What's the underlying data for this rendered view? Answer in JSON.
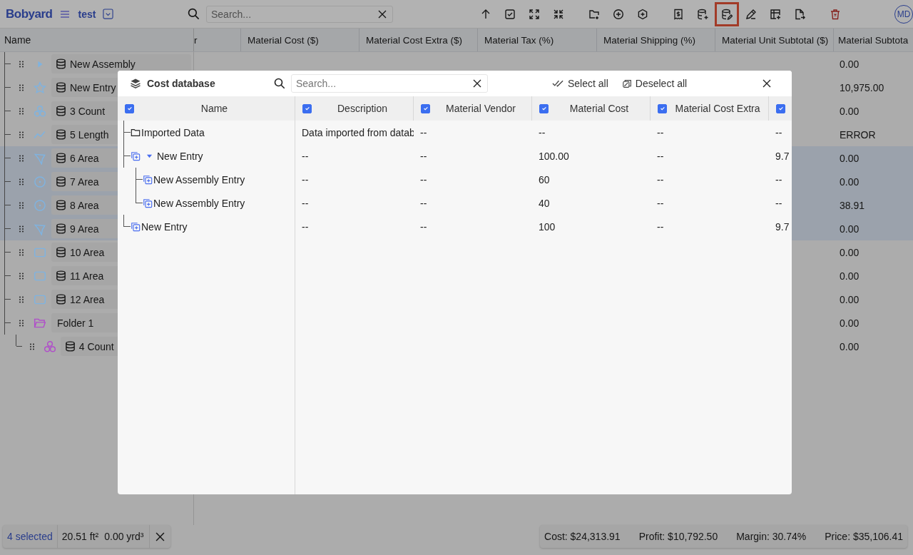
{
  "topbar": {
    "logo": "Bobyard",
    "project": "test",
    "search": {
      "placeholder": "Search..."
    },
    "toolbar": [
      [
        {
          "kind": "arrow-up",
          "selected": false
        },
        {
          "kind": "checkbox",
          "selected": false
        },
        {
          "kind": "expand",
          "selected": false
        },
        {
          "kind": "collapse",
          "selected": false
        }
      ],
      [
        {
          "kind": "folder-plus",
          "selected": false
        },
        {
          "kind": "plus-circle",
          "selected": false
        },
        {
          "kind": "plus-hexagon",
          "selected": false
        }
      ],
      [
        {
          "kind": "receipt",
          "selected": false
        },
        {
          "kind": "database-plus",
          "selected": false
        },
        {
          "kind": "database-edit",
          "selected": true
        },
        {
          "kind": "pencil",
          "selected": false
        },
        {
          "kind": "table-plus",
          "selected": false
        },
        {
          "kind": "file-arrow",
          "selected": false
        }
      ],
      [
        {
          "kind": "trash",
          "selected": false
        }
      ]
    ],
    "avatar": "MD"
  },
  "table": {
    "name_heading": "Name",
    "columns": [
      "r",
      "Material Cost ($)",
      "Material Cost Extra ($)",
      "Material Tax (%)",
      "Material Shipping (%)",
      "Material Unit Subtotal ($)",
      "Material Subtota"
    ]
  },
  "tree": [
    {
      "name": "New Assembly",
      "kind": "assembly",
      "color": "#7fb3e0",
      "selected": false,
      "subtotal": "0.00"
    },
    {
      "name": "New Entry",
      "kind": "star",
      "color": "#7fb3e0",
      "selected": false,
      "subtotal": "10,975.00"
    },
    {
      "name": "3 Count",
      "kind": "count",
      "color": "#7fb3e0",
      "selected": false,
      "subtotal": "0.00"
    },
    {
      "name": "5 Length",
      "kind": "length",
      "color": "#7fb3e0",
      "selected": false,
      "subtotal": "ERROR"
    },
    {
      "name": "6 Area",
      "kind": "polygon",
      "color": "#7fb3e0",
      "selected": true,
      "subtotal": "0.00"
    },
    {
      "name": "7 Area",
      "kind": "circle",
      "color": "#7fb3e0",
      "selected": true,
      "subtotal": "0.00"
    },
    {
      "name": "8 Area",
      "kind": "circle",
      "color": "#7fb3e0",
      "selected": true,
      "subtotal": "38.91"
    },
    {
      "name": "9 Area",
      "kind": "polygon",
      "color": "#7fb3e0",
      "selected": true,
      "subtotal": "0.00"
    },
    {
      "name": "10 Area",
      "kind": "rect",
      "color": "#7fb3e0",
      "selected": false,
      "subtotal": "0.00"
    },
    {
      "name": "11 Area",
      "kind": "rect",
      "color": "#7fb3e0",
      "selected": false,
      "subtotal": "0.00"
    },
    {
      "name": "12 Area",
      "kind": "rect",
      "color": "#7fb3e0",
      "selected": false,
      "subtotal": "0.00"
    },
    {
      "name": "Folder 1",
      "kind": "folder",
      "color": "#b04fc9",
      "selected": false,
      "subtotal": "0.00",
      "children": [
        {
          "name": "4 Count",
          "kind": "count",
          "color": "#b04fc9",
          "selected": false,
          "subtotal": "0.00"
        }
      ]
    }
  ],
  "selection": {
    "count": "4 selected",
    "area": "20.51 ft²",
    "volume": "0.00 yrd³"
  },
  "totals": [
    "Cost: $24,313.91",
    "Profit: $10,792.50",
    "Margin: 30.74%",
    "Price: $35,106.41"
  ],
  "modal": {
    "title": "Cost database",
    "search": {
      "placeholder": "Search..."
    },
    "select_all": "Select all",
    "deselect_all": "Deselect all",
    "name_column": {
      "label": "Name",
      "checked": true
    },
    "columns": [
      {
        "label": "Description",
        "checked": true
      },
      {
        "label": "Material Vendor",
        "checked": true
      },
      {
        "label": "Material Cost",
        "checked": true
      },
      {
        "label": "Material Cost Extra",
        "checked": true
      },
      {
        "checked": true
      }
    ],
    "rows": [
      {
        "name": "Imported Data",
        "kind": "folder",
        "cells": [
          "Data imported from datab",
          "--",
          "--",
          "--",
          "--"
        ]
      },
      {
        "name": "New Entry",
        "kind": "entry",
        "expanded": true,
        "cells": [
          "--",
          "--",
          "100.00",
          "--",
          "9.7"
        ],
        "children": [
          {
            "name": "New Assembly Entry",
            "kind": "entry",
            "cells": [
              "--",
              "--",
              "60",
              "--",
              "--"
            ]
          },
          {
            "name": "New Assembly Entry",
            "kind": "entry",
            "cells": [
              "--",
              "--",
              "40",
              "--",
              "--"
            ]
          }
        ]
      },
      {
        "name": "New Entry",
        "kind": "entry",
        "cells": [
          "--",
          "--",
          "100",
          "--",
          "9.7"
        ]
      }
    ]
  }
}
